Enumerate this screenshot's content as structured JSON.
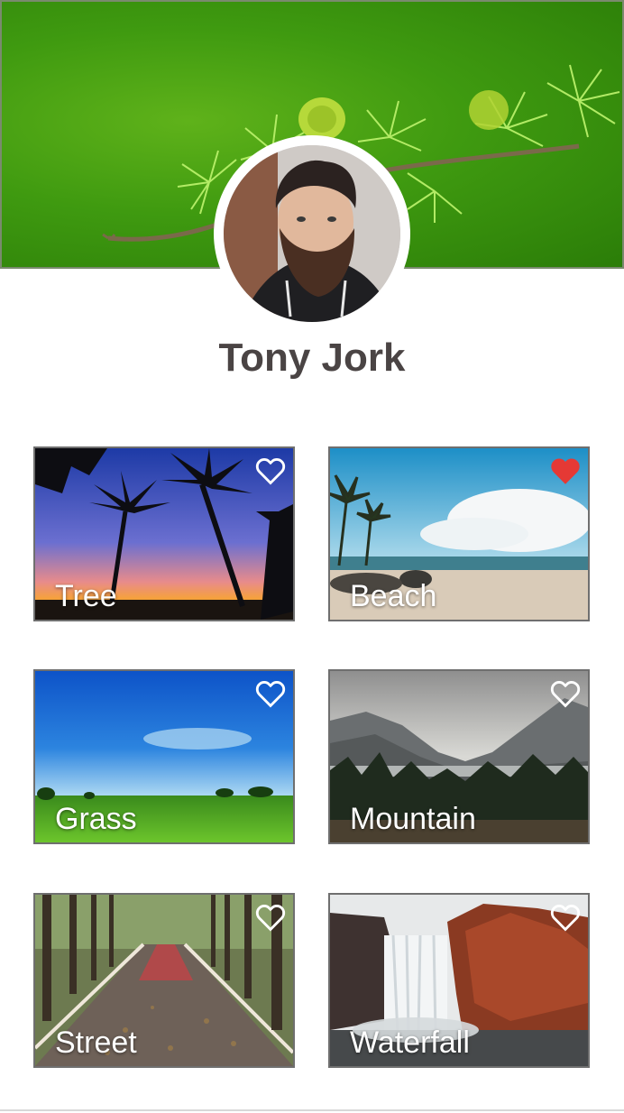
{
  "profile": {
    "name": "Tony Jork"
  },
  "colors": {
    "heart_active": "#e53935",
    "heart_outline": "#ffffff",
    "name_text": "#4a4444"
  },
  "cards": [
    {
      "label": "Tree",
      "favorited": false
    },
    {
      "label": "Beach",
      "favorited": true
    },
    {
      "label": "Grass",
      "favorited": false
    },
    {
      "label": "Mountain",
      "favorited": false
    },
    {
      "label": "Street",
      "favorited": false
    },
    {
      "label": "Waterfall",
      "favorited": false
    }
  ]
}
